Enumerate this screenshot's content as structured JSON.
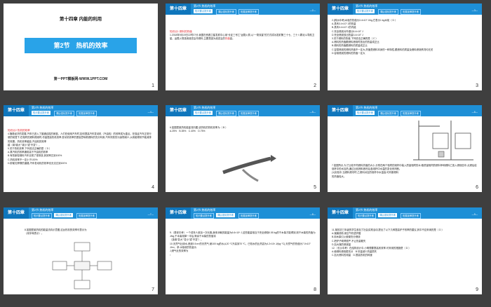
{
  "slides": [
    {
      "num": "1",
      "cover": {
        "chapter": "第十四章 内能的利用",
        "title": "第2节　热机的效率",
        "site": "第一PPT模板网-WWW.1PPT.COM"
      }
    },
    {
      "num": "2",
      "header": {
        "chapter": "第十四章",
        "title": "第2节 热机的效率",
        "tabs": [
          "知识要点提升练",
          "课后强化提升练",
          "拓展延伸提升练"
        ],
        "page": "—2—"
      },
      "body": {
        "section": "知识点1 燃料的热值",
        "text": "1.2018年9月19日22时07分,我国在西昌卫星发射中心用“长征三号乙”运载火箭,以“一箭双星”的方式成功发射第三十七、三十八颗北斗导航卫星。运载火箭选用液态氢作燃料,主要是因为液态氢的",
        "blank": "热值",
        "end": "高。"
      }
    },
    {
      "num": "3",
      "header": {
        "chapter": "第十四章",
        "title": "第2节 热机的效率",
        "tabs": [
          "知识要点提升练",
          "课后强化提升练",
          "拓展延伸提升练"
        ],
        "page": "—3—"
      },
      "body": {
        "lines": [
          "2.(株洲中考)木炭的热值为3.4×10⁷ J/kg,它表示1 kg木炭（ D ）",
          "A.具有3.4×10⁷ J的热量",
          "B.具有3.4×10⁷ J的内能",
          "C.完全燃烧对外做功3.4×10⁷ J",
          "D.完全燃烧放出热量3.4×10⁷ J",
          "3.关于燃料的热值,下列说法正确的是（ C ）",
          "A.燃料的热值跟燃料燃烧时放出的热量成正比",
          "B.燃料的热值跟燃料的质量成正比",
          "C.容易燃烧的燃料热值不一定大,热值是燃料本身的一种特性,跟燃料的质量及燃料燃烧情况均无关",
          "D.容易燃烧的燃料的热值一定大"
        ]
      }
    },
    {
      "num": "4",
      "header": {
        "chapter": "第十四章",
        "title": "第2节 热机的效率",
        "tabs": [
          "知识要点提升练",
          "课后强化提升练",
          "拓展延伸提升练"
        ],
        "page": "—4—"
      },
      "body": {
        "section": "知识点2 热机的效率",
        "lines": [
          "4.随着经济的发展,汽车已进入了普通百姓的家庭。人们在使用汽车时,如何提高汽车发动机（汽油机）的效率成为重点。在保证汽车正常行驶的前提下,在相同的燃料燃烧时,尽量提高热机效率,发动机效率的提高意味着燃料的充分利用,汽车排放的污染物减少,从而能得到节能减排的效果。热机效率越高,汽油机的效率",
          "越（填“增大”“减小”或“不变”）。",
          "5.关于热机效率,下列说法正确的是（ D ）",
          "A.蒸汽机的效率通常高于汽油机的效率",
          "B.有些新型燃料汽车实现了零排放,其效率达到100%",
          "C.热机效率不一定小于100%",
          "D.即使无摩擦的道路,汽车发动机的效率也无法达到100%"
        ]
      }
    },
    {
      "num": "5",
      "header": {
        "chapter": "第十四章",
        "title": "第2节 热机的效率",
        "tabs": [
          "知识要点提升练",
          "课后强化提升练",
          "拓展延伸提升练"
        ],
        "page": "—5—"
      },
      "body": {
        "lines": [
          "6.如图是某热机能量流向图,该热机的热机效率为（ B ）",
          "A.25%　B.35%　C.40%　D.75%"
        ],
        "diagram": [
          "燃料释放的能量",
          "废气带走的能量",
          "输出有用功"
        ]
      }
    },
    {
      "num": "6",
      "header": {
        "chapter": "第十四章",
        "title": "第2节 热机的效率",
        "tabs": [
          "知识要点提升练",
          "课后强化提升练",
          "拓展延伸提升练"
        ],
        "page": "—6—"
      },
      "body": {
        "lines": [
          "7.如图所示,为了比较不同燃料热值的大小,分别在两个相同的烧杯中装入质量相同的水,取质量相同的燃料甲和燃料乙放入燃烧皿中,点燃后给烧杯中的水加热,通过比较燃料燃尽后各烧杯中水温的变化来判断。",
          "(1)实验中,当燃料燃尽时,乙燃料对应的烧杯中水温高,可判断燃料",
          "的热值较大。"
        ]
      }
    },
    {
      "num": "7",
      "header": {
        "chapter": "第十四章",
        "title": "第2节 热机的效率",
        "tabs": [
          "知识要点提升练",
          "课后强化提升练",
          "拓展延伸提升练"
        ],
        "page": "—7—"
      },
      "body": {
        "lines": [
          "8.如图是某热机的能量流向示意图,这台热机的效率可表示为",
          "（用字母表示）。"
        ],
        "diagram": [
          "燃料完全燃烧放出的热量E",
          "有用功E₁",
          "克服摩擦损耗E₂",
          "废气带走E₃",
          "机械散热E₄"
        ]
      }
    },
    {
      "num": "8",
      "header": {
        "chapter": "第十四章",
        "title": "第2节 热机的效率",
        "tabs": [
          "知识要点提升练",
          "课后强化提升练",
          "拓展延伸提升练"
        ],
        "page": "—8—"
      },
      "body": {
        "lines": [
          "9.（泰安中考）一个成年人参加一次长跑,身体消耗的能量为6.6×10⁶ J,这些能量相当于完全燃烧0.55 kg的干木柴才能得到,则干木柴的热值为",
          "J/kg,干木柴用掉一半后,剩余干木柴的热值将",
          "（选填“变大”“变小”或“不变”）。",
          "10.天然气灶烧水,燃烧0.5 m³的天然气,使100 kg的水从20 ℃升高到70 ℃。已知水的比热容为4.2×10³ J/(kg·℃),天然气的热值为7.0×10⁷ J/m³。求:水吸收的热量为",
          "J,燃气灶的效率为",
          "。"
        ]
      }
    },
    {
      "num": "9",
      "header": {
        "chapter": "第十四章",
        "title": "第2节 热机的效率",
        "tabs": [
          "知识要点提升练",
          "课后强化提升练",
          "拓展延伸提升练"
        ],
        "page": "—9—"
      },
      "body": {
        "lines": [
          "11.某校初三年级的学生参加了社会实践活动,提出了以下几种提高炉子效率的建议,其中不应采纳的是（ D ）",
          "A.煤磨成粉,用空气吹进炉膛",
          "B.用木柴引火使煤充分燃烧",
          "C.把炉子砌得很严,不让热量散失",
          "D.加大煤的燃烧量",
          "12.（长沙中考）在结构设计中,小明想要提高其效率,可采用的措施是（ D ）",
          "A.使燃料燃烧更充分　B.尽量减少热量损失",
          "C.加大燃料的用量　D.提高热机的转速"
        ]
      }
    }
  ]
}
